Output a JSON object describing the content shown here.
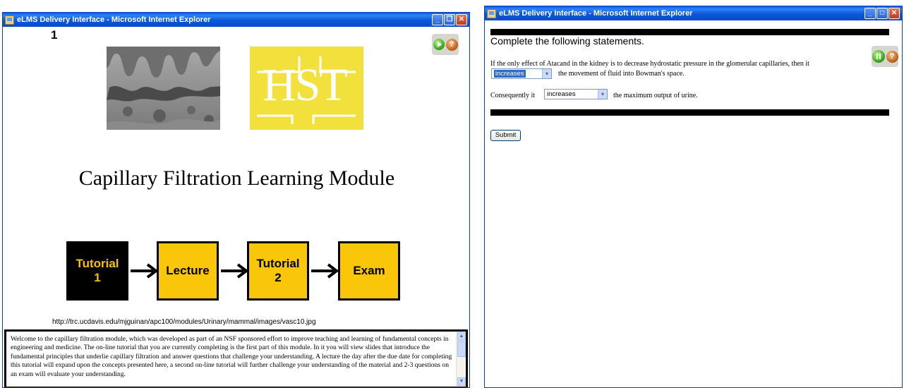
{
  "window1": {
    "title": "eLMS Delivery Interface - Microsoft Internet Explorer",
    "slide_number": "1",
    "hst_logo_text": "HST",
    "module_title": "Capillary Filtration Learning Module",
    "flow": [
      {
        "label": "Tutorial\n1"
      },
      {
        "label": "Lecture"
      },
      {
        "label": "Tutorial\n2"
      },
      {
        "label": "Exam"
      }
    ],
    "image_url": "http://trc.ucdavis.edu/mjguinan/apc100/modules/Urinary/mammal/images/vasc10.jpg",
    "intro_text": "Welcome to the capillary filtration module, which was developed as part of an NSF sponsored effort to improve teaching and learning of fundamental concepts in engineering and medicine. The on-line tutorial that you are currently completing is the first part of this module. In it you will view slides that introduce the fundamental principles that underlie capillary filtration and answer questions that challenge your understanding. A lecture the day after the due date for completing this tutorial will expand upon the concepts presented here, a second on-line tutorial will further challenge your understanding of the material and 2-3 questions on an exam will evaluate your understanding."
  },
  "window2": {
    "title": "eLMS Delivery Interface - Microsoft Internet Explorer",
    "heading": "Complete the following statements.",
    "q1_text": "If the only effect of Atacand in the kidney is to decrease hydrostatic pressure in the glomerular capillaries, then it",
    "q1_select": "increases",
    "q1_after": "the movement of fluid into Bowman's space.",
    "q2_before": "Consequently it",
    "q2_select": "increases",
    "q2_after": "the maximum output of urine.",
    "submit_label": "Submit"
  },
  "icons": {
    "minimize": "_",
    "maximize": "□",
    "restore": "❐",
    "close": "✕",
    "help": "?",
    "dropdown": "▾",
    "scroll_up": "▲",
    "scroll_down": "▼"
  },
  "colors": {
    "titlebar": "#0b57d9",
    "flow_active_bg": "#000000",
    "flow_active_text": "#f5c400",
    "flow_box": "#f9c60a",
    "hst_logo": "#f2e13c"
  }
}
